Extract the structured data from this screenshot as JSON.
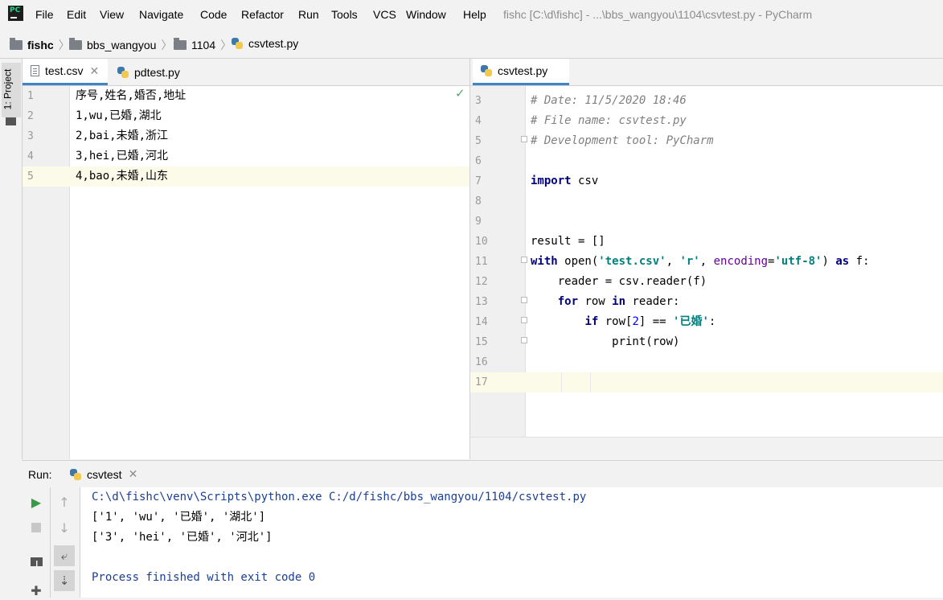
{
  "menubar": {
    "items": [
      "File",
      "Edit",
      "View",
      "Navigate",
      "Code",
      "Refactor",
      "Run",
      "Tools",
      "VCS",
      "Window",
      "Help"
    ],
    "window_title": "fishc [C:\\d\\fishc] - ...\\bbs_wangyou\\1104\\csvtest.py - PyCharm",
    "logo_text": "PC"
  },
  "breadcrumb": [
    "fishc",
    "bbs_wangyou",
    "1104",
    "csvtest.py"
  ],
  "tool_strip": {
    "project_label": "1: Project"
  },
  "left_editor": {
    "tabs": [
      {
        "label": "test.csv",
        "icon": "csv-file-icon",
        "active": true
      },
      {
        "label": "pdtest.py",
        "icon": "python-file-icon",
        "active": false
      }
    ],
    "lines": [
      {
        "num": "1",
        "text": "序号,姓名,婚否,地址"
      },
      {
        "num": "2",
        "text": "1,wu,已婚,湖北"
      },
      {
        "num": "3",
        "text": "2,bai,未婚,浙江"
      },
      {
        "num": "4",
        "text": "3,hei,已婚,河北"
      },
      {
        "num": "5",
        "text": "4,bao,未婚,山东"
      }
    ],
    "status_icon": "checkmark-icon"
  },
  "right_editor": {
    "tabs": [
      {
        "label": "csvtest.py",
        "icon": "python-file-icon",
        "active": true
      }
    ],
    "line_numbers": [
      "3",
      "4",
      "5",
      "6",
      "7",
      "8",
      "9",
      "10",
      "11",
      "12",
      "13",
      "14",
      "15",
      "16",
      "17"
    ],
    "code": {
      "l3": "# Date: 11/5/2020 18:46",
      "l4": "# File name: csvtest.py",
      "l5": "# Development tool: PyCharm",
      "l7_kw": "import",
      "l7_rest": " csv",
      "l10": "result = []",
      "l11_with": "with",
      "l11_open": " open(",
      "l11_s1": "'test.csv'",
      "l11_c1": ", ",
      "l11_s2": "'r'",
      "l11_c2": ", ",
      "l11_kwarg": "encoding",
      "l11_eq": "=",
      "l11_s3": "'utf-8'",
      "l11_close": ") ",
      "l11_as": "as",
      "l11_f": " f:",
      "l12": "    reader = csv.reader(f)",
      "l13_indent": "    ",
      "l13_for": "for",
      "l13_row": " row ",
      "l13_in": "in",
      "l13_rest": " reader:",
      "l14_indent": "        ",
      "l14_if": "if",
      "l14_row": " row[",
      "l14_num": "2",
      "l14_mid": "] == ",
      "l14_str": "'已婚'",
      "l14_end": ":",
      "l15": "            print(row)"
    }
  },
  "run_panel": {
    "label": "Run:",
    "tab_label": "csvtest",
    "console": [
      "C:\\d\\fishc\\venv\\Scripts\\python.exe C:/d/fishc/bbs_wangyou/1104/csvtest.py",
      "['1', 'wu', '已婚', '湖北']",
      "['3', 'hei', '已婚', '河北']",
      "",
      "Process finished with exit code 0"
    ]
  },
  "colors": {
    "accent": "#4083c9",
    "keyword": "#000080",
    "string": "#008080",
    "comment": "#808080",
    "console_path": "#1a3f93",
    "current_line": "#fcfae8"
  }
}
